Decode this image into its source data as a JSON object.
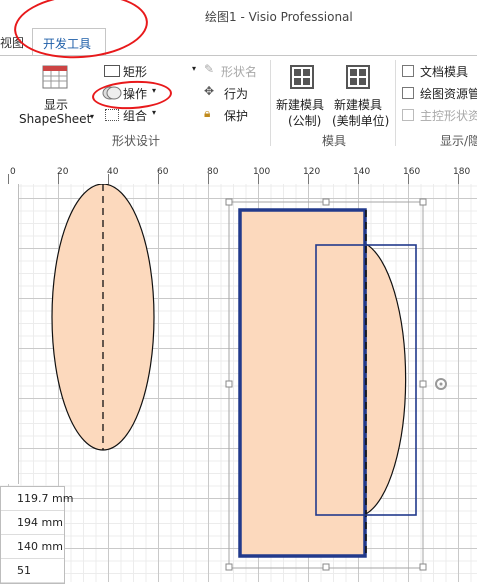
{
  "window": {
    "title": "绘图1 - Visio Professional"
  },
  "tabs": [
    {
      "label": "视图"
    },
    {
      "label": "开发工具"
    }
  ],
  "ribbon": {
    "show_shapesheet": {
      "line1": "显示",
      "line2": "ShapeSheet"
    },
    "shape_design": {
      "rectangle": "矩形",
      "operations": "操作",
      "group": "组合",
      "shape_name": "形状名",
      "behavior": "行为",
      "protect": "保护",
      "label": "形状设计"
    },
    "stencil": {
      "new_metric": {
        "line1": "新建模具",
        "line2": "(公制)"
      },
      "new_us": {
        "line1": "新建模具",
        "line2": "(美制单位)"
      },
      "label": "模具"
    },
    "show_hide": {
      "doc_stencil": "文档模具",
      "drawing_explorer": "绘图资源管",
      "master_explorer": "主控形状资",
      "label": "显示/隐"
    }
  },
  "ruler": {
    "labels": [
      "0",
      "20",
      "40",
      "60",
      "80",
      "100",
      "120",
      "140",
      "160",
      "180"
    ]
  },
  "size_panel": {
    "values": [
      "119.7 mm",
      "194 mm",
      "140 mm",
      "51"
    ]
  },
  "colors": {
    "shape_fill": "#fcd9bd",
    "selection_blue": "#223a8c",
    "annotation_red": "#e8191b",
    "tab_blue": "#1f5fa9"
  }
}
